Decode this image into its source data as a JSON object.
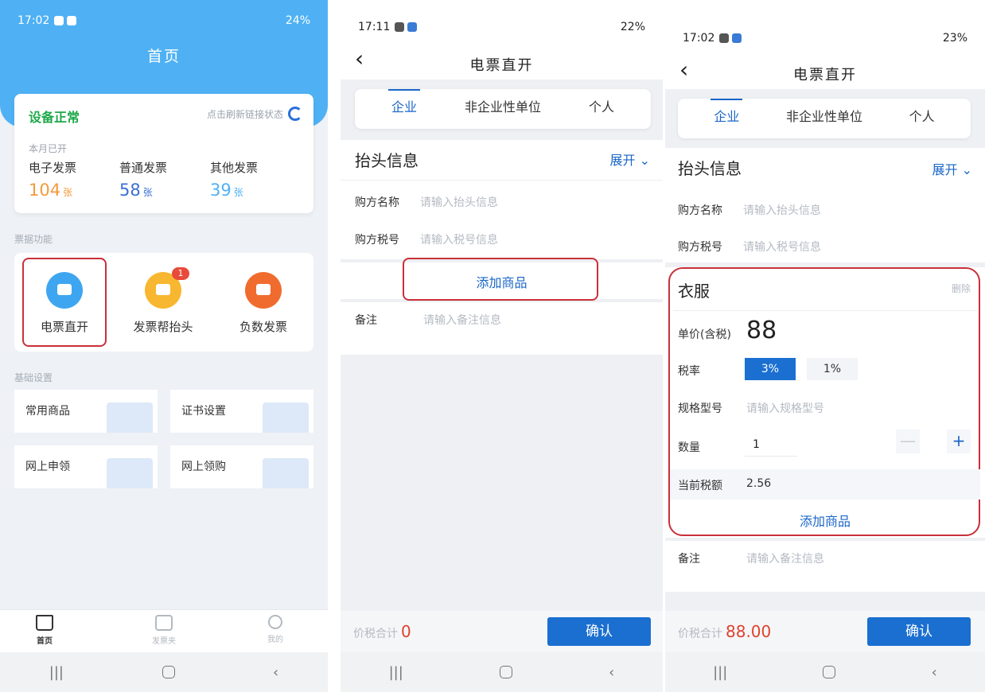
{
  "home": {
    "status_time": "17:02",
    "status_right": "24%",
    "title": "首页",
    "device_status": "设备正常",
    "refresh_label": "点击刷新链接状态",
    "month_label": "本月已开",
    "stats": [
      {
        "label": "电子发票",
        "value": "104",
        "unit": "张",
        "color": "#f39a3b"
      },
      {
        "label": "普通发票",
        "value": "58",
        "unit": "张",
        "color": "#3b6fd6"
      },
      {
        "label": "其他发票",
        "value": "39",
        "unit": "张",
        "color": "#4fb1f4"
      }
    ],
    "functions_label": "票据功能",
    "functions": [
      {
        "label": "电票直开",
        "color": "#3ea6f1"
      },
      {
        "label": "发票帮抬头",
        "color": "#f8b730",
        "badge": "1"
      },
      {
        "label": "负数发票",
        "color": "#f06c2e"
      }
    ],
    "settings_label": "基础设置",
    "tiles": [
      "常用商品",
      "证书设置",
      "网上申领",
      "网上领购"
    ],
    "tabs": [
      "首页",
      "发票夹",
      "我的"
    ]
  },
  "invoice": {
    "status_time_2": "17:11",
    "status_right_2": "22%",
    "status_time_3": "17:02",
    "status_right_3": "23%",
    "back": "‹",
    "title": "电票直开",
    "segments": [
      "企业",
      "非企业性单位",
      "个人"
    ],
    "header_section": "抬头信息",
    "expand": "展开",
    "buyer_name_label": "购方名称",
    "buyer_name_ph": "请输入抬头信息",
    "buyer_tax_label": "购方税号",
    "buyer_tax_ph": "请输入税号信息",
    "add_goods": "添加商品",
    "remark_label": "备注",
    "remark_ph": "请输入备注信息",
    "total_label": "价税合计",
    "total_value_2": "0",
    "total_value_3": "88.00",
    "confirm": "确认",
    "item": {
      "name": "衣服",
      "delete": "删除",
      "price_label": "单价(含税)",
      "price": "88",
      "rate_label": "税率",
      "rates": [
        "3%",
        "1%"
      ],
      "spec_label": "规格型号",
      "spec_ph": "请输入规格型号",
      "qty_label": "数量",
      "qty": "1",
      "minus": "—",
      "plus": "+",
      "tax_label": "当前税额",
      "tax_value": "2.56"
    }
  },
  "nav": {
    "recent": "|||",
    "back": "‹"
  }
}
